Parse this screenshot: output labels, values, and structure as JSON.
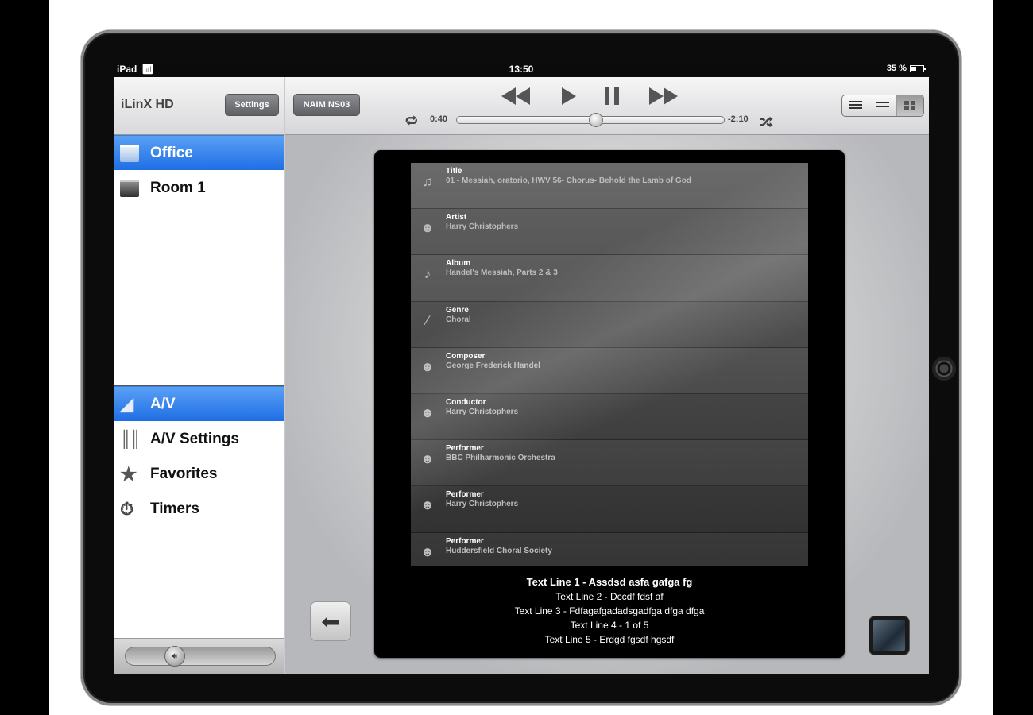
{
  "status_bar": {
    "device": "iPad",
    "wifi_icon": "wifi-icon",
    "time": "13:50",
    "battery": "35 %"
  },
  "sidebar": {
    "app_title": "iLinX HD",
    "settings_label": "Settings",
    "rooms": [
      {
        "label": "Office",
        "selected": true
      },
      {
        "label": "Room 1",
        "selected": false
      }
    ],
    "menu": [
      {
        "label": "A/V",
        "icon": "speaker-icon",
        "selected": true
      },
      {
        "label": "A/V Settings",
        "icon": "sliders-icon",
        "selected": false
      },
      {
        "label": "Favorites",
        "icon": "star-icon",
        "selected": false
      },
      {
        "label": "Timers",
        "icon": "timer-icon",
        "selected": false
      }
    ],
    "volume": {
      "level": 0.3
    }
  },
  "player": {
    "device_label": "NAIM NS03",
    "elapsed": "0:40",
    "remaining": "-2:10",
    "progress": 0.52
  },
  "metadata": [
    {
      "label": "Title",
      "value": "01 - Messiah, oratorio, HWV 56- Chorus- Behold the Lamb of God",
      "icon": "music-note-icon"
    },
    {
      "label": "Artist",
      "value": "Harry Christophers",
      "icon": "person-icon"
    },
    {
      "label": "Album",
      "value": "Handel's Messiah, Parts 2 & 3",
      "icon": "album-icon"
    },
    {
      "label": "Genre",
      "value": "Choral",
      "icon": "guitar-icon"
    },
    {
      "label": "Composer",
      "value": "George Frederick Handel",
      "icon": "composer-icon"
    },
    {
      "label": "Conductor",
      "value": "Harry Christophers",
      "icon": "conductor-icon"
    },
    {
      "label": "Performer",
      "value": "BBC Philharmonic Orchestra",
      "icon": "performer-icon"
    },
    {
      "label": "Performer",
      "value": "Harry Christophers",
      "icon": "performer-icon"
    },
    {
      "label": "Performer",
      "value": "Huddersfield Choral Society",
      "icon": "performer-icon"
    }
  ],
  "text_lines": [
    "Text Line 1 - Assdsd asfa gafga fg",
    "Text Line 2 - Dccdf fdsf af",
    "Text Line 3 - Fdfagafgadadsgadfga dfga dfga",
    "Text Line 4 - 1 of 5",
    "Text Line 5 - Erdgd fgsdf hgsdf"
  ]
}
